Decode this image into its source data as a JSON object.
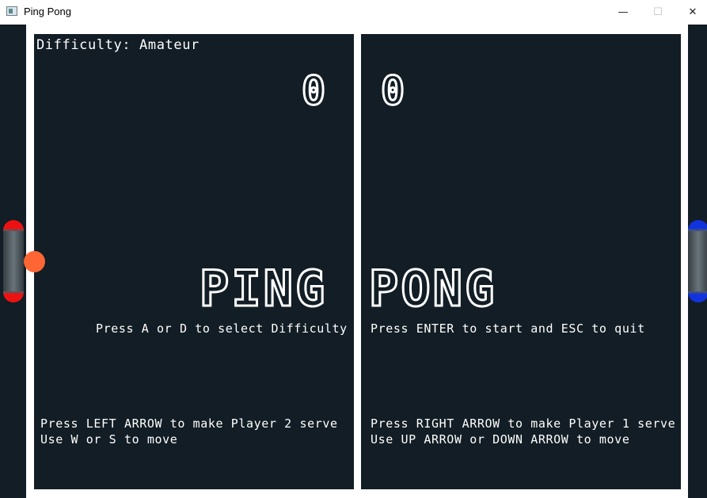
{
  "window": {
    "title": "Ping Pong",
    "controls": {
      "minimize": "—",
      "maximize": "☐",
      "close": "✕"
    },
    "icon": "app-window-icon"
  },
  "game": {
    "difficulty_label": "Difficulty: Amateur",
    "scores": {
      "player_left": "0",
      "player_right": "0"
    },
    "title_left": "PING",
    "title_right": "PONG",
    "instructions": {
      "difficulty": "Press A or D to select Difficulty",
      "start_quit": "Press ENTER to start and ESC to quit",
      "left_serve": "Press LEFT ARROW to make Player 2 serve",
      "left_move": "Use W or S to move",
      "right_serve": "Press RIGHT ARROW to make Player 1 serve",
      "right_move": "Use UP ARROW or DOWN ARROW to move"
    },
    "colors": {
      "background": "#121d25",
      "table_line": "#ffffff",
      "ball": "#ff6633",
      "left_paddle_accent": "#ee1111",
      "right_paddle_accent": "#1133dd",
      "paddle_body": "#4f5c63"
    }
  }
}
